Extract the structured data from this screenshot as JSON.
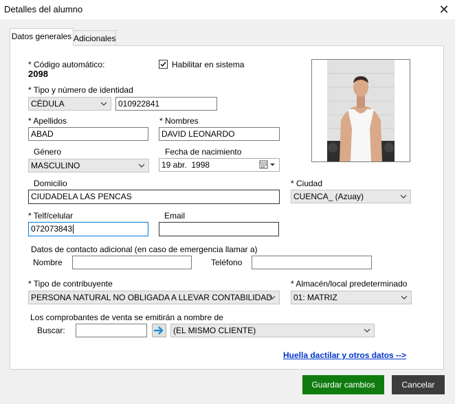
{
  "window": {
    "title": "Detalles del alumno",
    "close_glyph": "✕"
  },
  "tabs": [
    {
      "label": "Datos generales",
      "active": true
    },
    {
      "label": "Adicionales",
      "active": false
    }
  ],
  "auto_code": {
    "label": "* Código automático:",
    "value": "2098"
  },
  "enable_system": {
    "label": "Habilitar en sistema",
    "checked": true
  },
  "identity": {
    "label": "* Tipo y número de identidad",
    "type": "CÉDULA",
    "number": "010922841"
  },
  "surnames": {
    "label": "* Apellidos",
    "value": "ABAD"
  },
  "names": {
    "label": "* Nombres",
    "value": "DAVID LEONARDO"
  },
  "gender": {
    "label": "Género",
    "value": "MASCULINO"
  },
  "birth_date": {
    "label": "Fecha de nacimiento",
    "value": "19 abr.  1998"
  },
  "address": {
    "label": "Domicilio",
    "value": "CIUDADELA LAS PENCAS"
  },
  "city": {
    "label": "* Ciudad",
    "value": "CUENCA_ (Azuay)"
  },
  "phone": {
    "label": "* Telf/celular",
    "value": "072073843"
  },
  "email": {
    "label": "Email",
    "value": ""
  },
  "emergency": {
    "label": "Datos de contacto adicional (en caso de emergencia llamar a)",
    "name_label": "Nombre",
    "name_value": "",
    "phone_label": "Teléfono",
    "phone_value": ""
  },
  "taxpayer": {
    "label": "* Tipo de contribuyente",
    "value": "PERSONA NATURAL NO OBLIGADA A LLEVAR CONTABILIDAD"
  },
  "warehouse": {
    "label": "* Almacén/local predeterminado",
    "value": "01: MATRIZ"
  },
  "invoice": {
    "label": "Los comprobantes de venta se emitirán a nombre de",
    "search_label": "Buscar:",
    "search_value": "",
    "client": "(EL MISMO CLIENTE)"
  },
  "link_text": "Huella dactilar y otros datos -->",
  "buttons": {
    "save": "Guardar cambios",
    "cancel": "Cancelar"
  },
  "colors": {
    "save_bg": "#107c10",
    "cancel_bg": "#3c3c3c",
    "link": "#0033cc",
    "focus_border": "#0078d7"
  },
  "icons": [
    "close-icon",
    "check-icon",
    "chevron-down-icon",
    "calendar-icon",
    "arrow-right-icon",
    "student-photo"
  ]
}
